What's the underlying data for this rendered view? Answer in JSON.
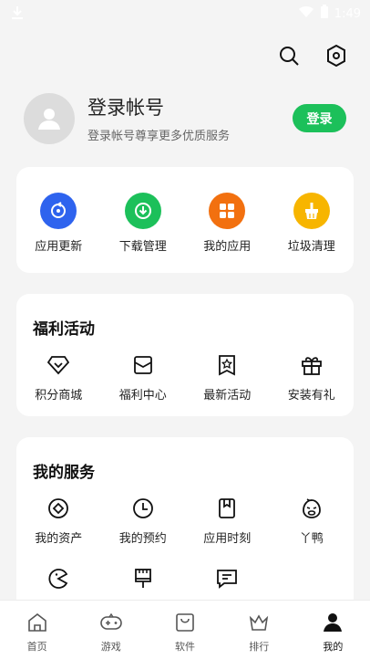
{
  "status_bar": {
    "time": "1:49",
    "icons": [
      "download-icon",
      "wifi-icon",
      "battery-icon"
    ]
  },
  "header": {
    "icons": [
      "search-icon",
      "settings-hexagon-icon"
    ]
  },
  "profile": {
    "title": "登录帐号",
    "subtitle": "登录帐号尊享更多优质服务",
    "login_label": "登录"
  },
  "quick_actions": [
    {
      "label": "应用更新",
      "icon": "refresh-icon",
      "color": "#2e63ee"
    },
    {
      "label": "下载管理",
      "icon": "download-icon",
      "color": "#1cc05a"
    },
    {
      "label": "我的应用",
      "icon": "apps-grid-icon",
      "color": "#f2700f"
    },
    {
      "label": "垃圾清理",
      "icon": "broom-icon",
      "color": "#f7b500"
    }
  ],
  "welfare": {
    "title": "福利活动",
    "items": [
      {
        "label": "积分商城",
        "icon": "diamond-icon"
      },
      {
        "label": "福利中心",
        "icon": "envelope-icon"
      },
      {
        "label": "最新活动",
        "icon": "star-badge-icon"
      },
      {
        "label": "安装有礼",
        "icon": "gift-icon"
      }
    ]
  },
  "services": {
    "title": "我的服务",
    "items": [
      {
        "label": "我的资产",
        "icon": "coin-icon"
      },
      {
        "label": "我的预约",
        "icon": "clock-icon"
      },
      {
        "label": "应用时刻",
        "icon": "bookmark-icon"
      },
      {
        "label": "丫鸭",
        "icon": "duck-icon"
      }
    ],
    "items_row2": [
      {
        "label": "",
        "icon": "pacman-icon"
      },
      {
        "label": "",
        "icon": "paintbrush-icon"
      },
      {
        "label": "",
        "icon": "chat-icon"
      }
    ]
  },
  "bottom_nav": [
    {
      "label": "首页",
      "icon": "home-icon",
      "active": false
    },
    {
      "label": "游戏",
      "icon": "gamepad-icon",
      "active": false
    },
    {
      "label": "软件",
      "icon": "bag-icon",
      "active": false
    },
    {
      "label": "排行",
      "icon": "crown-icon",
      "active": false
    },
    {
      "label": "我的",
      "icon": "person-icon",
      "active": true
    }
  ]
}
